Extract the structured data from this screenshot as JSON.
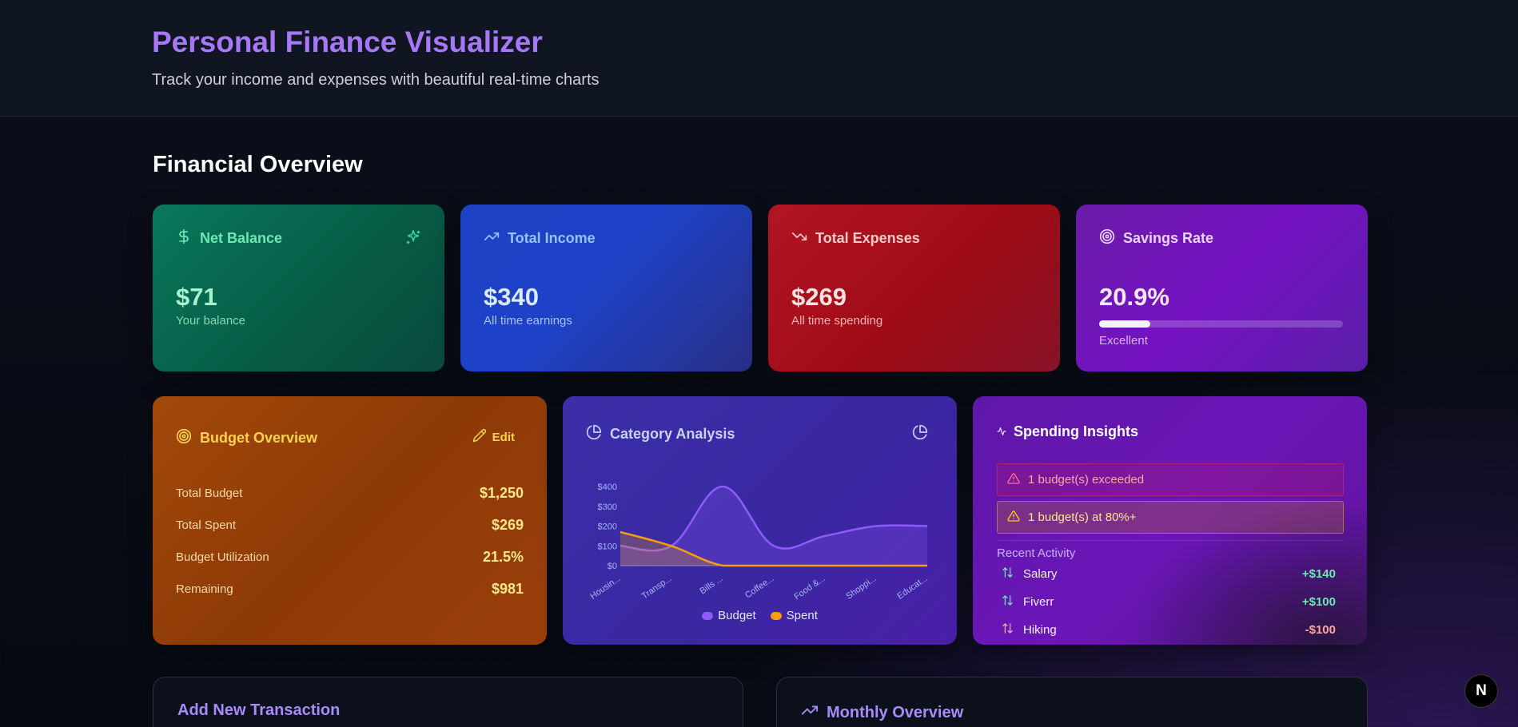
{
  "header": {
    "title": "Personal Finance Visualizer",
    "subtitle": "Track your income and expenses with beautiful real-time charts"
  },
  "overview": {
    "title": "Financial Overview",
    "net_balance": {
      "label": "Net Balance",
      "value": "$71",
      "sub": "Your balance",
      "icon": "dollar-icon",
      "accent": "#6ee7b7"
    },
    "total_income": {
      "label": "Total Income",
      "value": "$340",
      "sub": "All time earnings",
      "icon": "trending-up-icon",
      "accent": "#93c5fd"
    },
    "total_expenses": {
      "label": "Total Expenses",
      "value": "$269",
      "sub": "All time spending",
      "icon": "trending-down-icon",
      "accent": "#fca5a5"
    },
    "savings_rate": {
      "label": "Savings Rate",
      "value": "20.9%",
      "sub": "Excellent",
      "icon": "target-icon",
      "progress": 0.209,
      "accent": "#d8b4fe"
    }
  },
  "budget": {
    "title": "Budget Overview",
    "edit_label": "Edit",
    "rows": [
      {
        "label": "Total Budget",
        "value": "$1,250"
      },
      {
        "label": "Total Spent",
        "value": "$269"
      },
      {
        "label": "Budget Utilization",
        "value": "21.5%"
      },
      {
        "label": "Remaining",
        "value": "$981"
      }
    ]
  },
  "category": {
    "title": "Category Analysis",
    "legend": {
      "budget": "Budget",
      "spent": "Spent"
    }
  },
  "chart_data": {
    "type": "area",
    "categories": [
      "Housin...",
      "Transp...",
      "Bills ...",
      "Coffee...",
      "Food &...",
      "Shoppi...",
      "Educat..."
    ],
    "ytick_labels": [
      "$0",
      "$100",
      "$200",
      "$300",
      "$400"
    ],
    "ylim": [
      0,
      400
    ],
    "series": [
      {
        "name": "Budget",
        "values": [
          100,
          100,
          400,
          100,
          150,
          200,
          200
        ],
        "color": "#8b5cf6"
      },
      {
        "name": "Spent",
        "values": [
          170,
          99,
          0,
          0,
          0,
          0,
          0
        ],
        "color": "#f59e0b"
      }
    ],
    "legend_position": "bottom"
  },
  "insights": {
    "title": "Spending Insights",
    "alerts": [
      {
        "text": "1 budget(s) exceeded",
        "level": "danger"
      },
      {
        "text": "1 budget(s) at 80%+",
        "level": "warning"
      }
    ],
    "recent_label": "Recent Activity",
    "activity": [
      {
        "name": "Salary",
        "amount": "+$140",
        "type": "income"
      },
      {
        "name": "Fiverr",
        "amount": "+$100",
        "type": "income"
      },
      {
        "name": "Hiking",
        "amount": "-$100",
        "type": "expense"
      }
    ]
  },
  "panels": {
    "add_transaction": "Add New Transaction",
    "monthly_overview": "Monthly Overview"
  },
  "badge": {
    "letter": "N"
  }
}
